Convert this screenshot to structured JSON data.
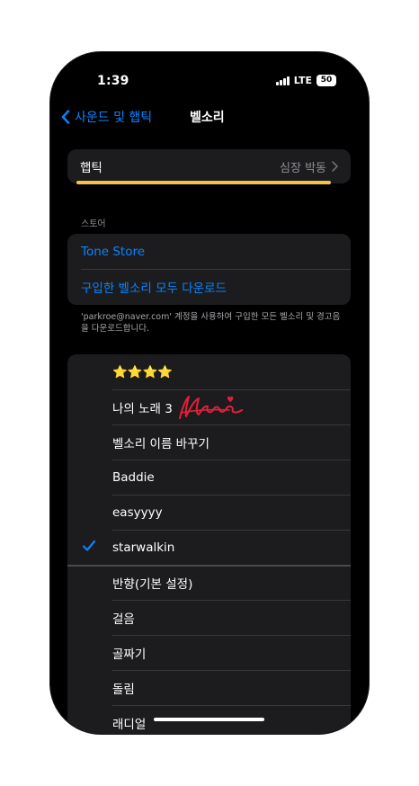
{
  "status_bar": {
    "time": "1:39",
    "network": "LTE",
    "battery": "50"
  },
  "nav": {
    "back_label": "사운드 및 햅틱",
    "title": "벨소리"
  },
  "haptic": {
    "label": "햅틱",
    "value": "심장 박동"
  },
  "store_section": {
    "header": "스토어",
    "items": [
      "Tone Store",
      "구입한 벨소리 모두 다운로드"
    ],
    "footnote": "'parkroe@naver.com' 계정을 사용하여 구입한 모든 벨소리 및 경고음을 다운로드합니다."
  },
  "ringtones": {
    "custom": [
      "⭐⭐⭐⭐",
      "나의 노래 3",
      "벨소리 이름 바꾸기",
      "Baddie",
      "easyyyy",
      "starwalkin"
    ],
    "selected": "starwalkin",
    "standard": [
      "반향(기본 설정)",
      "걸음",
      "골짜기",
      "돌림",
      "래디얼"
    ]
  },
  "colors": {
    "accent": "#0a84ff",
    "highlight": "#f5c542",
    "signature": "#e0203a"
  }
}
